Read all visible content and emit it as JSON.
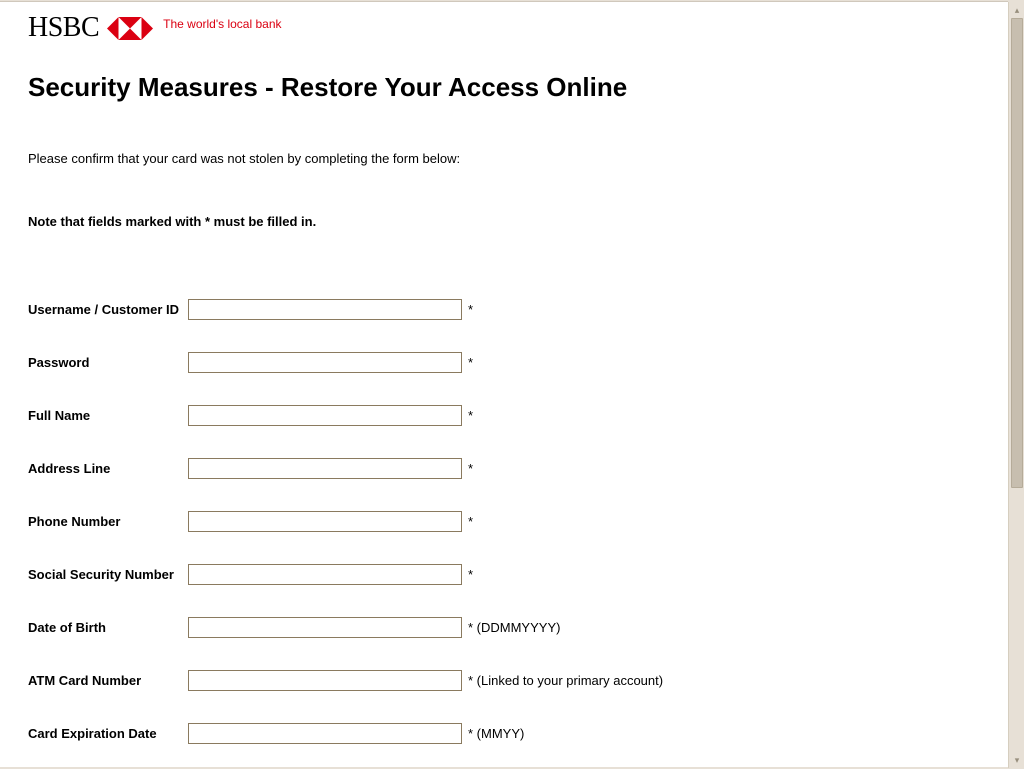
{
  "header": {
    "logo_text": "HSBC",
    "tagline": "The world's local bank"
  },
  "main": {
    "title": "Security Measures - Restore Your Access Online",
    "intro": "Please confirm that your card was not stolen by completing the form below:",
    "note": "Note that fields marked with * must be filled in."
  },
  "form": {
    "fields": [
      {
        "label": "Username / Customer ID",
        "hint": "*",
        "value": ""
      },
      {
        "label": "Password",
        "hint": "*",
        "value": ""
      },
      {
        "label": "Full Name",
        "hint": "*",
        "value": ""
      },
      {
        "label": "Address Line",
        "hint": "*",
        "value": ""
      },
      {
        "label": "Phone Number",
        "hint": "*",
        "value": ""
      },
      {
        "label": "Social Security Number",
        "hint": "*",
        "value": ""
      },
      {
        "label": "Date of Birth",
        "hint": "* (DDMMYYYY)",
        "value": ""
      },
      {
        "label": "ATM Card Number",
        "hint": "* (Linked to your primary account)",
        "value": ""
      },
      {
        "label": "Card Expiration Date",
        "hint": "* (MMYY)",
        "value": ""
      }
    ]
  }
}
